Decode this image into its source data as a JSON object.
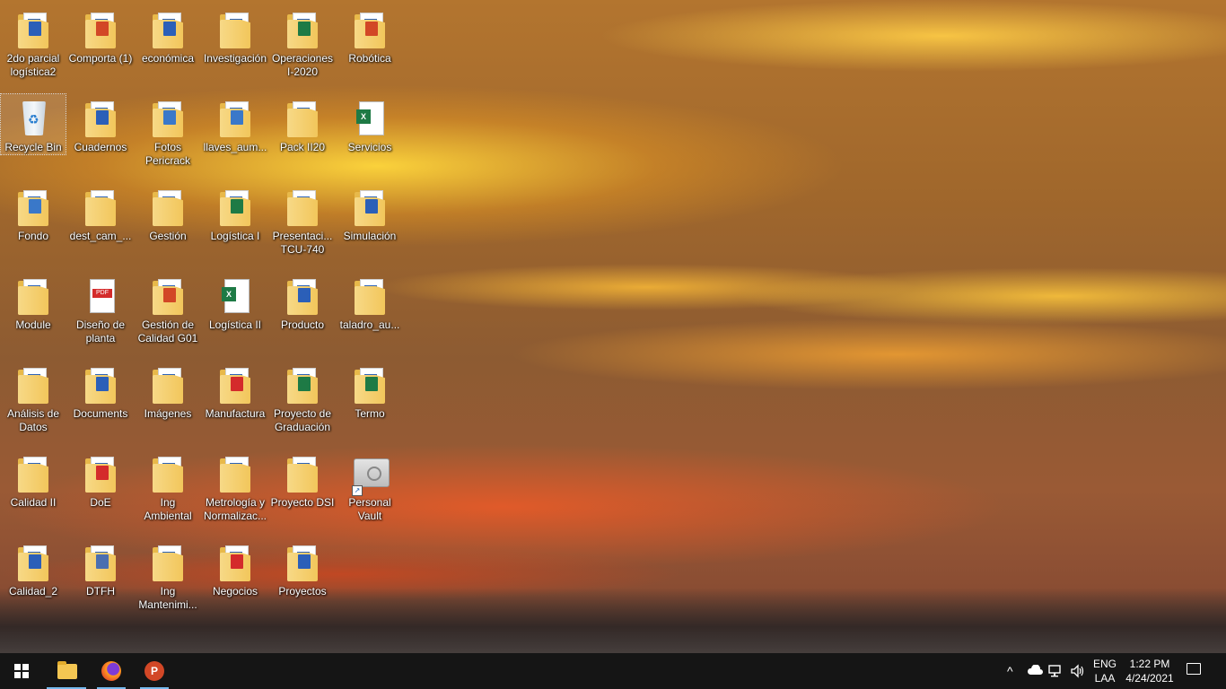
{
  "desktop": {
    "icons": [
      {
        "label": "2do parcial logística2",
        "type": "folder",
        "tag": "word"
      },
      {
        "label": "Comporta (1)",
        "type": "folder",
        "tag": "ppt"
      },
      {
        "label": "económica",
        "type": "folder",
        "tag": "word"
      },
      {
        "label": "Investigación",
        "type": "folder",
        "tag": ""
      },
      {
        "label": "Operaciones I-2020",
        "type": "folder",
        "tag": "excel"
      },
      {
        "label": "Robótica",
        "type": "folder",
        "tag": "ppt"
      },
      {
        "label": "Recycle Bin",
        "type": "recycle-bin",
        "tag": ""
      },
      {
        "label": "Cuadernos",
        "type": "folder",
        "tag": "word"
      },
      {
        "label": "Fotos Pericrack",
        "type": "folder",
        "tag": "img"
      },
      {
        "label": "llaves_aum...",
        "type": "folder",
        "tag": "img"
      },
      {
        "label": "Pack II20",
        "type": "folder",
        "tag": ""
      },
      {
        "label": "Servicios",
        "type": "excel-file",
        "tag": "excel"
      },
      {
        "label": "Fondo",
        "type": "folder",
        "tag": "img"
      },
      {
        "label": "dest_cam_...",
        "type": "folder",
        "tag": ""
      },
      {
        "label": "Gestión",
        "type": "folder",
        "tag": ""
      },
      {
        "label": "Logística I",
        "type": "folder",
        "tag": "excel"
      },
      {
        "label": "Presentaci... TCU-740",
        "type": "folder",
        "tag": ""
      },
      {
        "label": "Simulación",
        "type": "folder",
        "tag": "word"
      },
      {
        "label": "Module",
        "type": "folder",
        "tag": ""
      },
      {
        "label": "Diseño de planta",
        "type": "pdf-file",
        "tag": "pdf"
      },
      {
        "label": "Gestión de Calidad G01",
        "type": "folder",
        "tag": "ppt"
      },
      {
        "label": "Logística II",
        "type": "excel-file",
        "tag": "excel"
      },
      {
        "label": "Producto",
        "type": "folder",
        "tag": "word"
      },
      {
        "label": "taladro_au...",
        "type": "folder",
        "tag": ""
      },
      {
        "label": "Análisis de Datos",
        "type": "folder",
        "tag": ""
      },
      {
        "label": "Documents",
        "type": "folder",
        "tag": "word"
      },
      {
        "label": "Imágenes",
        "type": "folder",
        "tag": ""
      },
      {
        "label": "Manufactura",
        "type": "folder",
        "tag": "pdf"
      },
      {
        "label": "Proyecto de Graduación",
        "type": "folder",
        "tag": "excel"
      },
      {
        "label": "Termo",
        "type": "folder",
        "tag": "excel"
      },
      {
        "label": "Calidad II",
        "type": "folder",
        "tag": ""
      },
      {
        "label": "DoE",
        "type": "folder",
        "tag": "pdf"
      },
      {
        "label": "Ing Ambiental",
        "type": "folder",
        "tag": ""
      },
      {
        "label": "Metrología y Normalizac...",
        "type": "folder",
        "tag": ""
      },
      {
        "label": "Proyecto DSI",
        "type": "folder",
        "tag": ""
      },
      {
        "label": "Personal Vault",
        "type": "vault",
        "tag": ""
      },
      {
        "label": "Calidad_2",
        "type": "folder",
        "tag": "word"
      },
      {
        "label": "DTFH",
        "type": "folder",
        "tag": "music"
      },
      {
        "label": "Ing Mantenimi...",
        "type": "folder",
        "tag": ""
      },
      {
        "label": "Negocios",
        "type": "folder",
        "tag": "pdf"
      },
      {
        "label": "Proyectos",
        "type": "folder",
        "tag": "word"
      }
    ]
  },
  "taskbar": {
    "start": "windows-icon",
    "pinned": [
      {
        "name": "file-explorer-icon",
        "active": true
      },
      {
        "name": "firefox-icon",
        "active": false
      },
      {
        "name": "powerpoint-icon",
        "active": false,
        "letter": "P"
      }
    ],
    "tray": {
      "chevron": "^",
      "language_top": "ENG",
      "language_bottom": "LAA",
      "time": "1:22 PM",
      "date": "4/24/2021"
    }
  },
  "colors": {
    "taskbar": "#151515",
    "accent": "#76b9ed"
  }
}
